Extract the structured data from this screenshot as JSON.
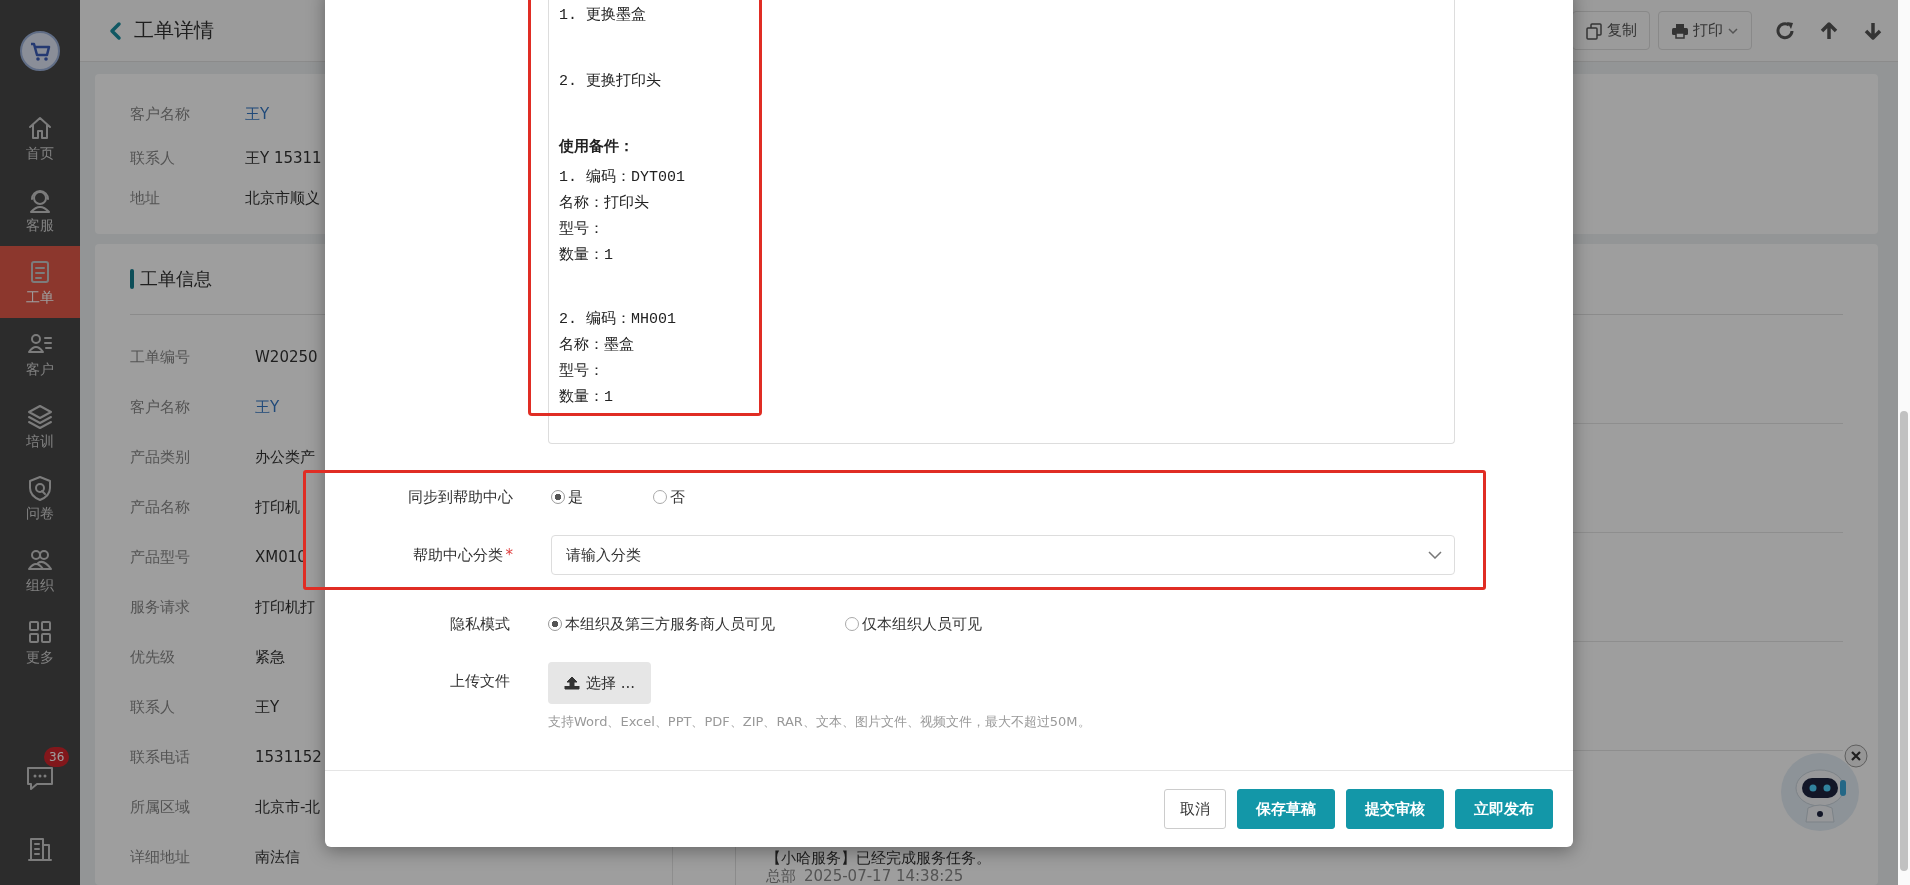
{
  "sidebar": {
    "items": [
      {
        "label": "首页",
        "selected": false
      },
      {
        "label": "客服",
        "selected": false
      },
      {
        "label": "工单",
        "selected": true
      },
      {
        "label": "客户",
        "selected": false
      },
      {
        "label": "培训",
        "selected": false
      },
      {
        "label": "问卷",
        "selected": false
      },
      {
        "label": "组织",
        "selected": false
      },
      {
        "label": "更多",
        "selected": false
      }
    ],
    "chat_badge": "36"
  },
  "page": {
    "title": "工单详情",
    "toolbar": [
      "复制",
      "打印"
    ],
    "customer_card": {
      "rows": [
        {
          "label": "客户名称",
          "value": "王Y",
          "link": true
        },
        {
          "label": "联系人",
          "value": "王Y 15311",
          "link": false
        },
        {
          "label": "地址",
          "value": "北京市顺义",
          "link": false
        }
      ]
    },
    "info_card": {
      "title": "工单信息",
      "rows": [
        {
          "label": "工单编号",
          "value": "W20250",
          "link": false
        },
        {
          "label": "客户名称",
          "value": "王Y",
          "link": true
        },
        {
          "label": "产品类别",
          "value": "办公类产",
          "link": false
        },
        {
          "label": "产品名称",
          "value": "打印机",
          "link": false
        },
        {
          "label": "产品型号",
          "value": "XM010",
          "link": false
        },
        {
          "label": "服务请求",
          "value": "打印机打",
          "link": false
        },
        {
          "label": "优先级",
          "value": "紧急",
          "link": false
        },
        {
          "label": "联系人",
          "value": "王Y",
          "link": false
        },
        {
          "label": "联系电话",
          "value": "1531152",
          "link": false
        },
        {
          "label": "所属区域",
          "value": "北京市-北",
          "link": false
        },
        {
          "label": "详细地址",
          "value": "南法信",
          "link": false
        }
      ]
    },
    "activity": {
      "text": "【小哈服务】已经完成服务任务。",
      "source": "总部",
      "time": "2025-07-17 14:38:25"
    }
  },
  "dialog": {
    "content": {
      "highlighted": true,
      "blocks": [
        {
          "kind": "item",
          "lines": [
            "1. 更换墨盒"
          ]
        },
        {
          "kind": "item",
          "lines": [
            "2. 更换打印头"
          ]
        },
        {
          "kind": "heading",
          "lines": [
            "使用备件："
          ]
        },
        {
          "kind": "part",
          "lines": [
            "1. 编码：DYT001",
            "名称：打印头",
            "型号：",
            "数量：1"
          ]
        },
        {
          "kind": "part",
          "lines": [
            "2. 编码：MH001",
            "名称：墨盒",
            "型号：",
            "数量：1"
          ]
        }
      ]
    },
    "help_center": {
      "highlighted": true,
      "sync": {
        "label": "同步到帮助中心",
        "options": [
          {
            "label": "是",
            "selected": true
          },
          {
            "label": "否",
            "selected": false
          }
        ]
      },
      "category": {
        "label": "帮助中心分类",
        "required_mark": "*",
        "placeholder": "请输入分类"
      }
    },
    "privacy": {
      "label": "隐私模式",
      "options": [
        {
          "label": "本组织及第三方服务商人员可见",
          "selected": true
        },
        {
          "label": "仅本组织人员可见",
          "selected": false
        }
      ]
    },
    "upload": {
      "label": "上传文件",
      "button": "选择 ...",
      "hint": "支持Word、Excel、PPT、PDF、ZIP、RAR、文本、图片文件、视频文件，最大不超过50M。"
    },
    "buttons": [
      {
        "label": "取消",
        "kind": "default"
      },
      {
        "label": "保存草稿",
        "kind": "primary"
      },
      {
        "label": "提交审核",
        "kind": "primary"
      },
      {
        "label": "立即发布",
        "kind": "primary"
      }
    ]
  }
}
